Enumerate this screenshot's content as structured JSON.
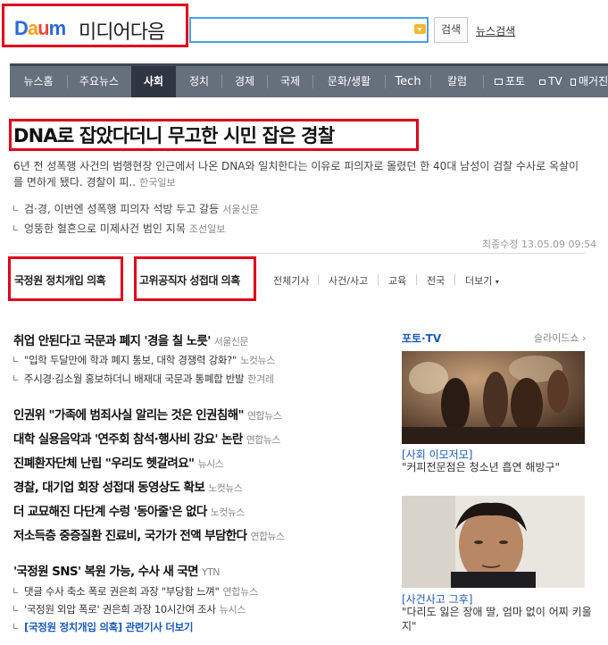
{
  "header": {
    "logo_brand": [
      "D",
      "a",
      "u",
      "m"
    ],
    "logo_text": "미디어다음",
    "search_placeholder": "",
    "search_button": "검색",
    "news_search": "뉴스검색"
  },
  "nav": {
    "items": [
      {
        "label": "뉴스홈"
      },
      {
        "label": "주요뉴스"
      },
      {
        "label": "사회",
        "active": true
      },
      {
        "label": "정치"
      },
      {
        "label": "경제"
      },
      {
        "label": "국제"
      },
      {
        "label": "문화/생활"
      },
      {
        "label": "Tech"
      },
      {
        "label": "칼럼"
      },
      {
        "label": "포토"
      },
      {
        "label": "TV"
      },
      {
        "label": "매거진"
      }
    ]
  },
  "top_story": {
    "headline": "DNA로 잡았다더니 무고한 시민 잡은 경찰",
    "summary": "6년 전 성폭행 사건의 범행현장 인근에서 나온 DNA와 일치한다는 이유로 피의자로 몰렸던 한 40대 남성이 검찰 수사로 옥살이를 면하게 됐다. 경찰이 피..",
    "summary_source": "한국일보",
    "related": [
      {
        "title": "검·경, 이번엔 성폭행 피의자 석방 두고 갈등",
        "source": "서울신문"
      },
      {
        "title": "엉뚱한 혈흔으로 미제사건 범인 지목",
        "source": "조선일보"
      }
    ],
    "updated": "최종수정 13.05.09 09:54"
  },
  "issue_tabs": {
    "tab1": "국정원 정치개입 의혹",
    "tab2": "고위공직자 성접대 의혹",
    "categories": [
      "전체기사",
      "사건/사고",
      "교육",
      "전국",
      "더보기"
    ]
  },
  "articles": {
    "a1": {
      "title": "취업 안된다고 국문과 폐지 '경을 칠 노릇'",
      "source": "서울신문"
    },
    "a1_subs": [
      {
        "title": "\"입학 두달만에 학과 폐지 통보, 대학 경쟁력 강화?\"",
        "source": "노컷뉴스"
      },
      {
        "title": "주시경·김소월 홍보하더니 배재대 국문과 통폐합 반발",
        "source": "한겨레"
      }
    ],
    "list": [
      {
        "title": "인권위 \"가족에 범죄사실 알리는 것은 인권침해\"",
        "source": "연합뉴스"
      },
      {
        "title": "대학 실용음악과 '연주회 참석·행사비 강요' 논란",
        "source": "연합뉴스"
      },
      {
        "title": "진폐환자단체 난립 \"우리도 헷갈려요\"",
        "source": "뉴시스"
      },
      {
        "title": "경찰, 대기업 회장 성접대 동영상도 확보",
        "source": "노컷뉴스"
      },
      {
        "title": "더 교묘해진 다단계 수렁 '동아줄'은 없다",
        "source": "노컷뉴스"
      },
      {
        "title": "저소득층 중증질환 진료비, 국가가 전액 부담한다",
        "source": "연합뉴스"
      }
    ],
    "a2": {
      "title": "'국정원 SNS' 복원 가능, 수사 새 국면",
      "source": "YTN"
    },
    "a2_subs": [
      {
        "title": "댓글 수사 축소 폭로 권은희 과장 \"부당함 느껴\"",
        "source": "연합뉴스"
      },
      {
        "title": "'국정원 외압 폭로' 권은희 과장 10시간여 조사",
        "source": "뉴시스"
      }
    ],
    "more_link": "[국정원 정치개입 의혹] 관련기사 더보기"
  },
  "photo_tv": {
    "title": "포토·TV",
    "slideshow": "슬라이드쇼",
    "items": [
      {
        "tag": "[사회 이모저모]",
        "caption": "\"커피전문점은 청소년 흡연 해방구\""
      },
      {
        "tag": "[사건사고 그후]",
        "caption": "\"다리도 잃은 장애 딸, 엄마 없이 어찌 키울지\""
      }
    ]
  }
}
